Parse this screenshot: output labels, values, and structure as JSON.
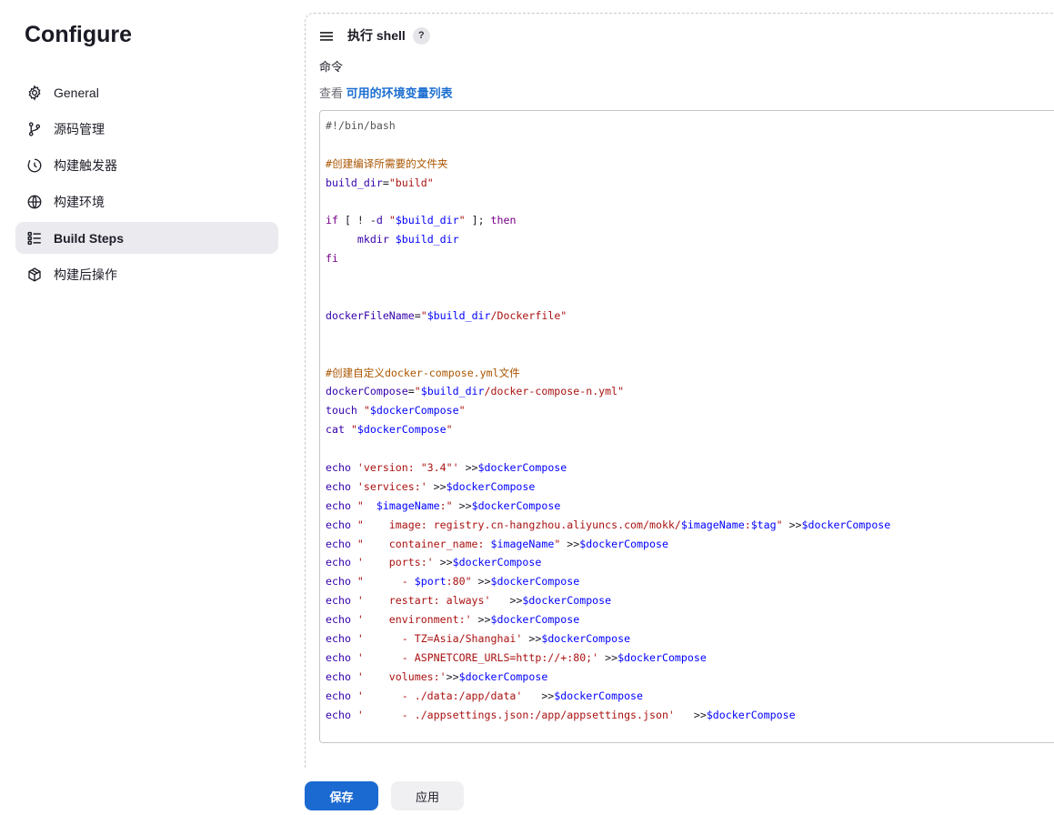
{
  "sidebar": {
    "title": "Configure",
    "items": [
      {
        "label": "General",
        "icon": "gear-icon"
      },
      {
        "label": "源码管理",
        "icon": "branch-icon"
      },
      {
        "label": "构建触发器",
        "icon": "timer-icon"
      },
      {
        "label": "构建环境",
        "icon": "globe-icon"
      },
      {
        "label": "Build Steps",
        "icon": "list-icon",
        "active": true
      },
      {
        "label": "构建后操作",
        "icon": "package-icon"
      }
    ]
  },
  "step": {
    "title": "执行 shell",
    "help": "?",
    "command_label": "命令",
    "env_prefix": "查看",
    "env_link": "可用的环境变量列表"
  },
  "script_lines": [
    "#!/bin/bash",
    "",
    "#创建编译所需要的文件夹",
    "build_dir=\"build\"",
    "",
    "if [ ! -d \"$build_dir\" ]; then",
    "     mkdir $build_dir",
    "fi",
    "",
    "",
    "dockerFileName=\"$build_dir/Dockerfile\"",
    "",
    "",
    "#创建自定义docker-compose.yml文件",
    "dockerCompose=\"$build_dir/docker-compose-n.yml\"",
    "touch \"$dockerCompose\"",
    "cat \"$dockerCompose\"",
    "",
    "echo 'version: \"3.4\"' >>$dockerCompose",
    "echo 'services:' >>$dockerCompose",
    "echo \"  $imageName:\" >>$dockerCompose",
    "echo \"    image: registry.cn-hangzhou.aliyuncs.com/mokk/$imageName:$tag\" >>$dockerCompose",
    "echo \"    container_name: $imageName\" >>$dockerCompose",
    "echo '    ports:' >>$dockerCompose",
    "echo \"      - $port:80\" >>$dockerCompose",
    "echo '    restart: always'   >>$dockerCompose",
    "echo '    environment:' >>$dockerCompose",
    "echo '      - TZ=Asia/Shanghai' >>$dockerCompose",
    "echo '      - ASPNETCORE_URLS=http://+:80;' >>$dockerCompose",
    "echo '    volumes:'>>$dockerCompose",
    "echo '      - ./data:/app/data'   >>$dockerCompose",
    "echo '      - ./appsettings.json:/app/appsettings.json'   >>$dockerCompose"
  ],
  "actions": {
    "save": "保存",
    "apply": "应用"
  },
  "colors": {
    "accent": "#1b6ad1",
    "active_nav_bg": "#eaeaef"
  }
}
